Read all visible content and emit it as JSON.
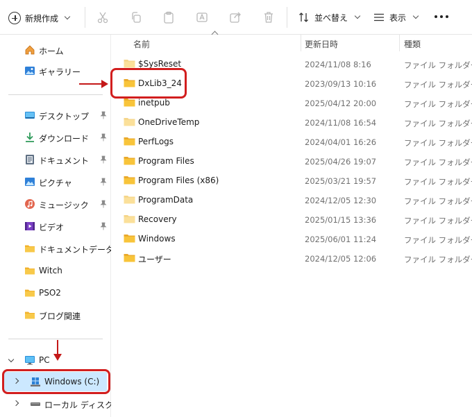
{
  "toolbar": {
    "new_label": "新規作成",
    "sort_label": "並べ替え",
    "view_label": "表示"
  },
  "sidebar": {
    "quick": [
      {
        "label": "ホーム",
        "icon": "home-icon"
      },
      {
        "label": "ギャラリー",
        "icon": "gallery-icon"
      }
    ],
    "pinned": [
      {
        "label": "デスクトップ",
        "icon": "desktop-icon"
      },
      {
        "label": "ダウンロード",
        "icon": "download-icon"
      },
      {
        "label": "ドキュメント",
        "icon": "document-icon"
      },
      {
        "label": "ピクチャ",
        "icon": "pictures-icon"
      },
      {
        "label": "ミュージック",
        "icon": "music-icon"
      },
      {
        "label": "ビデオ",
        "icon": "video-icon"
      }
    ],
    "folders": [
      {
        "label": "ドキュメントデータ"
      },
      {
        "label": "Witch"
      },
      {
        "label": "PSO2"
      },
      {
        "label": "ブログ関連"
      }
    ],
    "pc_label": "PC",
    "drive_c": "Windows (C:)",
    "drive_d": "ローカル ディスク (D:)"
  },
  "columns": {
    "name": "名前",
    "date": "更新日時",
    "type": "種類"
  },
  "files": [
    {
      "name": "$SysReset",
      "date": "2024/11/08 8:16",
      "type": "ファイル フォルダー",
      "dim": true
    },
    {
      "name": "DxLib3_24",
      "date": "2023/09/13 10:16",
      "type": "ファイル フォルダー",
      "dim": false
    },
    {
      "name": "inetpub",
      "date": "2025/04/12 20:00",
      "type": "ファイル フォルダー",
      "dim": false
    },
    {
      "name": "OneDriveTemp",
      "date": "2024/11/08 16:54",
      "type": "ファイル フォルダー",
      "dim": true
    },
    {
      "name": "PerfLogs",
      "date": "2024/04/01 16:26",
      "type": "ファイル フォルダー",
      "dim": false
    },
    {
      "name": "Program Files",
      "date": "2025/04/26 19:07",
      "type": "ファイル フォルダー",
      "dim": false
    },
    {
      "name": "Program Files (x86)",
      "date": "2025/03/21 19:57",
      "type": "ファイル フォルダー",
      "dim": false
    },
    {
      "name": "ProgramData",
      "date": "2024/12/05 12:30",
      "type": "ファイル フォルダー",
      "dim": true
    },
    {
      "name": "Recovery",
      "date": "2025/01/15 13:36",
      "type": "ファイル フォルダー",
      "dim": true
    },
    {
      "name": "Windows",
      "date": "2025/06/01 11:24",
      "type": "ファイル フォルダー",
      "dim": false
    },
    {
      "name": "ユーザー",
      "date": "2024/12/05 12:06",
      "type": "ファイル フォルダー",
      "dim": false
    }
  ],
  "colors": {
    "folder": "#f8c43a",
    "folder_dim": "#fbe09a",
    "selected": "#cce8ff",
    "annotation": "#d21e1e"
  }
}
